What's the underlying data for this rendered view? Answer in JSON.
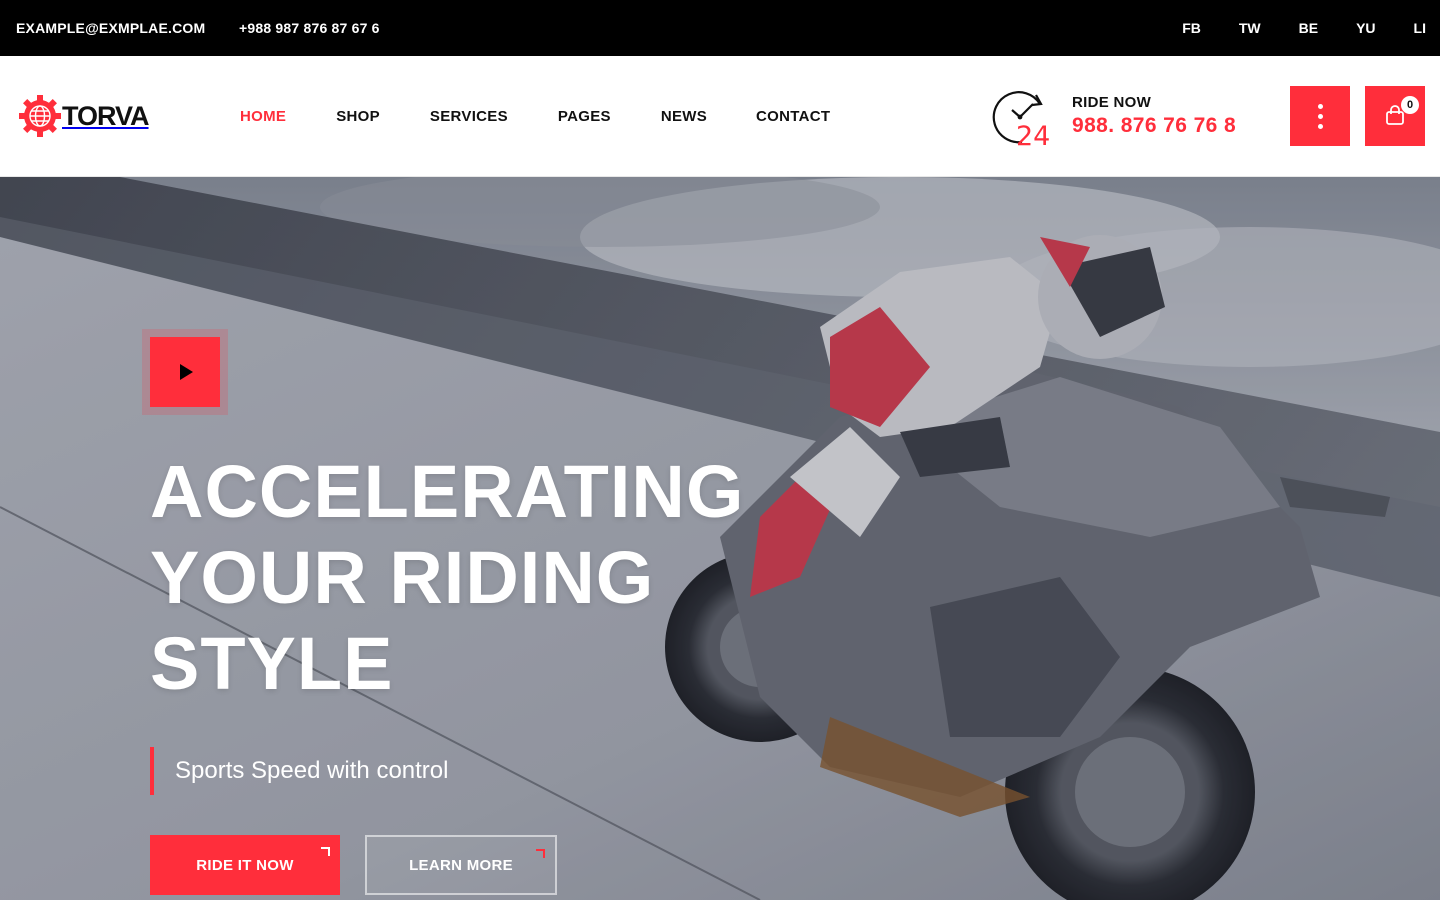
{
  "topbar": {
    "email": "EXAMPLE@EXMPLAE.COM",
    "phone": "+988 987 876 87 67 6",
    "socials": [
      "FB",
      "TW",
      "BE",
      "YU",
      "LI"
    ]
  },
  "header": {
    "logo_text": "TORVA",
    "nav": [
      "HOME",
      "SHOP",
      "SERVICES",
      "PAGES",
      "NEWS",
      "CONTACT"
    ],
    "active_nav": "HOME",
    "ride_now_label": "RIDE NOW",
    "ride_now_phone": "988. 876 76 76 8",
    "clock_number": "24",
    "cart_count": "0"
  },
  "hero": {
    "title_lines": [
      "ACCELERATING",
      "YOUR RIDING",
      "STYLE"
    ],
    "tagline": "Sports Speed with control",
    "primary_button": "RIDE IT NOW",
    "secondary_button": "LEARN MORE"
  },
  "colors": {
    "accent": "#ff2e3b",
    "topbar_bg": "#000000",
    "header_bg": "#ffffff",
    "text_dark": "#111111"
  },
  "icons": {
    "logo": "gear-globe-icon",
    "ride_now": "clock-24-icon",
    "menu": "vertical-dots-icon",
    "cart": "shopping-bag-icon",
    "play": "play-icon"
  }
}
